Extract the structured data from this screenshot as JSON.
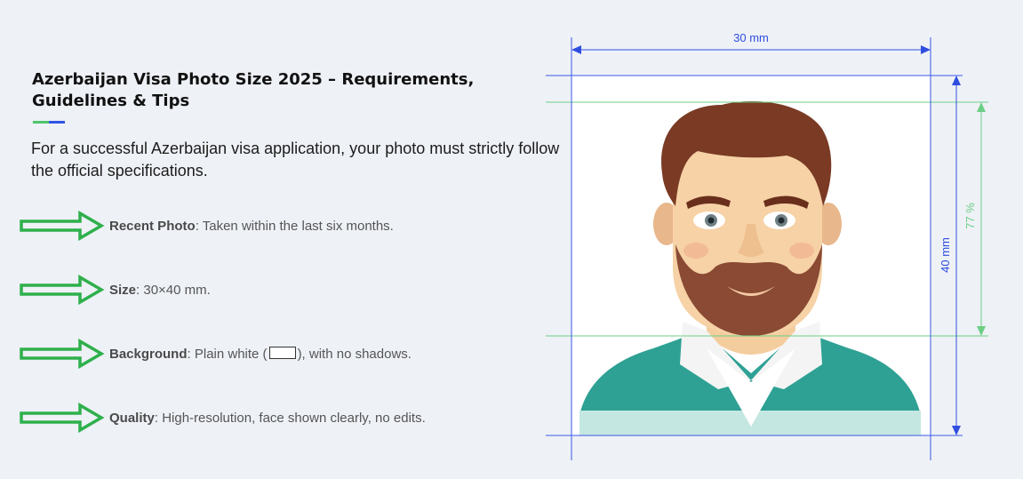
{
  "heading": "Azerbaijan Visa Photo Size 2025 – Requirements, Guidelines & Tips",
  "intro": "For a successful Azerbaijan visa application, your photo must strictly follow the official specifications.",
  "requirements": [
    {
      "label": "Recent Photo",
      "text": ": Taken within the last six months."
    },
    {
      "label": "Size",
      "text": ": 30×40 mm."
    },
    {
      "label": "Background",
      "text_before": ": Plain white (",
      "text_after": "), with no shadows."
    },
    {
      "label": "Quality",
      "text": ": High-resolution, face shown clearly, no edits."
    }
  ],
  "diagram": {
    "width_label": "30 mm",
    "height_label": "40 mm",
    "head_ratio_label": "77 %"
  },
  "colors": {
    "arrow_green": "#2eb04c",
    "dimension_blue": "#2f4ee0",
    "guide_green": "#6ccf85",
    "underline_green": "#4ec46a",
    "underline_blue": "#2f55e4"
  },
  "icons": [
    "right-arrow-icon",
    "white-swatch-icon",
    "person-avatar-illustration"
  ]
}
